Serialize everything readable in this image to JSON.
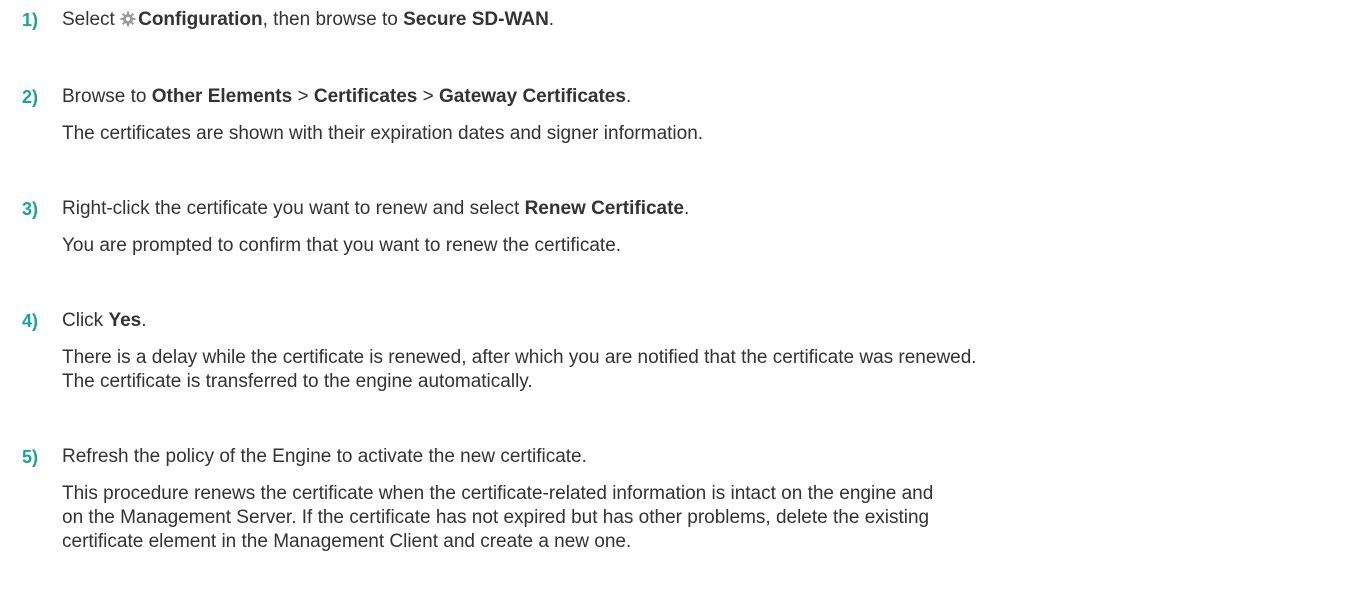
{
  "steps": [
    {
      "number": "1)",
      "instruction": {
        "t1": "Select ",
        "icon": "gear-icon",
        "b1": "Configuration",
        "t2": ", then browse to ",
        "b2": "Secure SD-WAN",
        "t3": "."
      }
    },
    {
      "number": "2)",
      "instruction": {
        "t1": "Browse to ",
        "b1": "Other Elements",
        "t2": " > ",
        "b2": "Certificates",
        "t3": " > ",
        "b3": "Gateway Certificates",
        "t4": "."
      },
      "result": [
        "The certificates are shown with their expiration dates and signer information."
      ]
    },
    {
      "number": "3)",
      "instruction": {
        "t1": "Right-click the certificate you want to renew and select ",
        "b1": "Renew Certificate",
        "t2": "."
      },
      "result": [
        "You are prompted to confirm that you want to renew the certificate."
      ]
    },
    {
      "number": "4)",
      "instruction": {
        "t1": "Click ",
        "b1": "Yes",
        "t2": "."
      },
      "result": [
        "There is a delay while the certificate is renewed, after which you are notified that the certificate was renewed.",
        "The certificate is transferred to the engine automatically."
      ]
    },
    {
      "number": "5)",
      "instruction": {
        "t1": "Refresh the policy of the Engine to activate the new certificate."
      },
      "result": [
        "This procedure renews the certificate when the certificate-related information is intact on the engine and",
        "on the Management Server. If the certificate has not expired but has other problems, delete the existing",
        "certificate element in the Management Client and create a new one."
      ]
    }
  ],
  "colors": {
    "step_number": "#1aa39b",
    "text": "#333333",
    "icon": "#9a9a9a"
  }
}
